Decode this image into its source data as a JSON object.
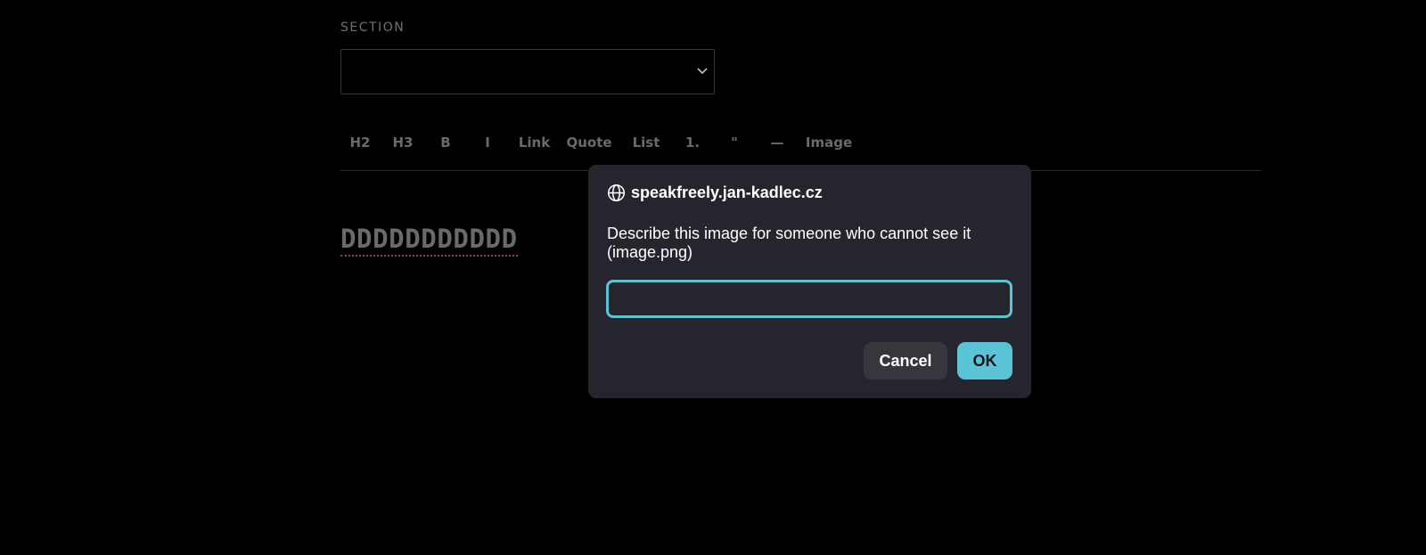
{
  "form": {
    "section_label": "SECTION",
    "section_value": ""
  },
  "toolbar": {
    "buttons": [
      {
        "label": "H2"
      },
      {
        "label": "H3"
      },
      {
        "label": "B"
      },
      {
        "label": "I"
      },
      {
        "label": "Link"
      },
      {
        "label": "Quote"
      },
      {
        "label": "List"
      },
      {
        "label": "1."
      },
      {
        "label": "\""
      },
      {
        "label": "—"
      },
      {
        "label": "Image"
      }
    ]
  },
  "editor": {
    "content": "DDDDDDDDDDD"
  },
  "dialog": {
    "origin": "speakfreely.jan-kadlec.cz",
    "message": "Describe this image for someone who cannot see it (image.png)",
    "input_value": "",
    "cancel_label": "Cancel",
    "ok_label": "OK",
    "icon": "globe-icon",
    "accent_color": "#5bc3d6"
  }
}
